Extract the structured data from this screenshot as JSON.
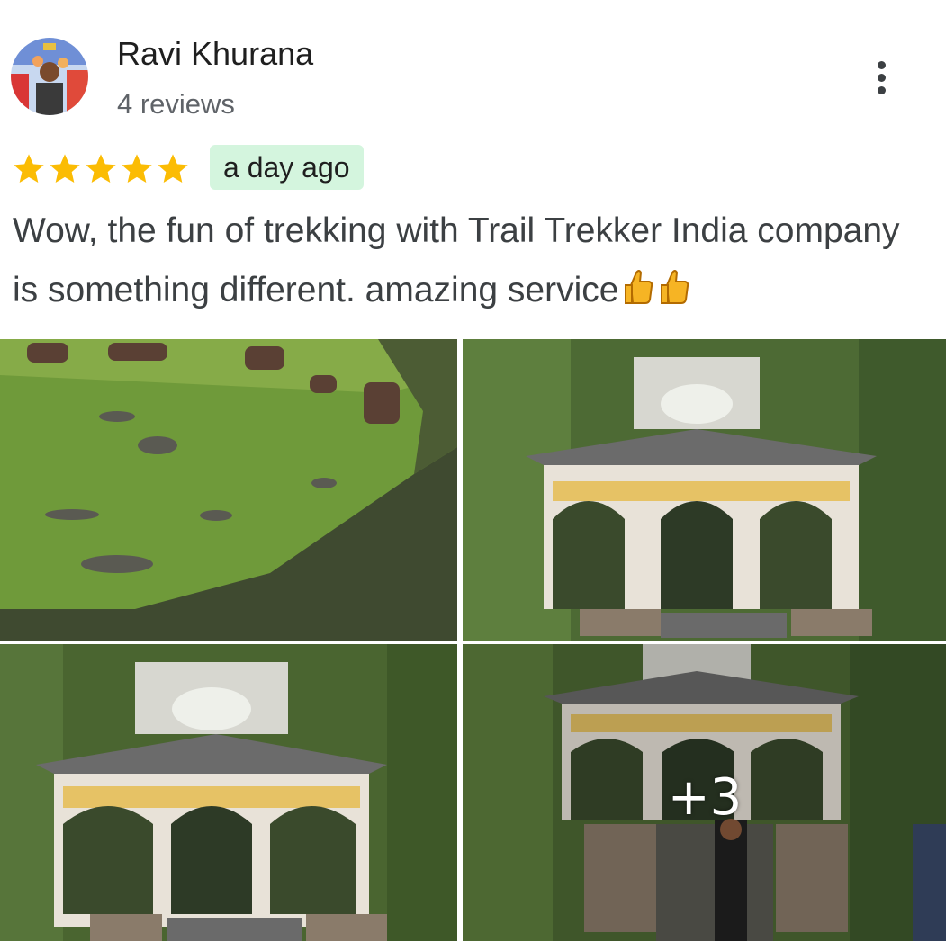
{
  "reviewer": {
    "name": "Ravi Khurana",
    "review_count": "4 reviews",
    "avatar_icon": "reviewer-avatar"
  },
  "review": {
    "rating": 5,
    "max_rating": 5,
    "date": "a day ago",
    "text": "Wow, the fun of trekking with Trail Trekker India company is something different. amazing service",
    "emojis": [
      "thumbs-up-icon",
      "thumbs-up-icon"
    ]
  },
  "photos": {
    "items": [
      {
        "subject": "horses-grazing-meadow"
      },
      {
        "subject": "temple-shrine"
      },
      {
        "subject": "temple-shrine"
      },
      {
        "subject": "temple-shrine-with-person"
      }
    ],
    "more_label": "+3"
  },
  "colors": {
    "star": "#fbbc04",
    "date_badge_bg": "#d4f5de",
    "text": "#3c4043"
  },
  "icons": {
    "menu": "more-vert-icon",
    "star": "star-icon"
  }
}
